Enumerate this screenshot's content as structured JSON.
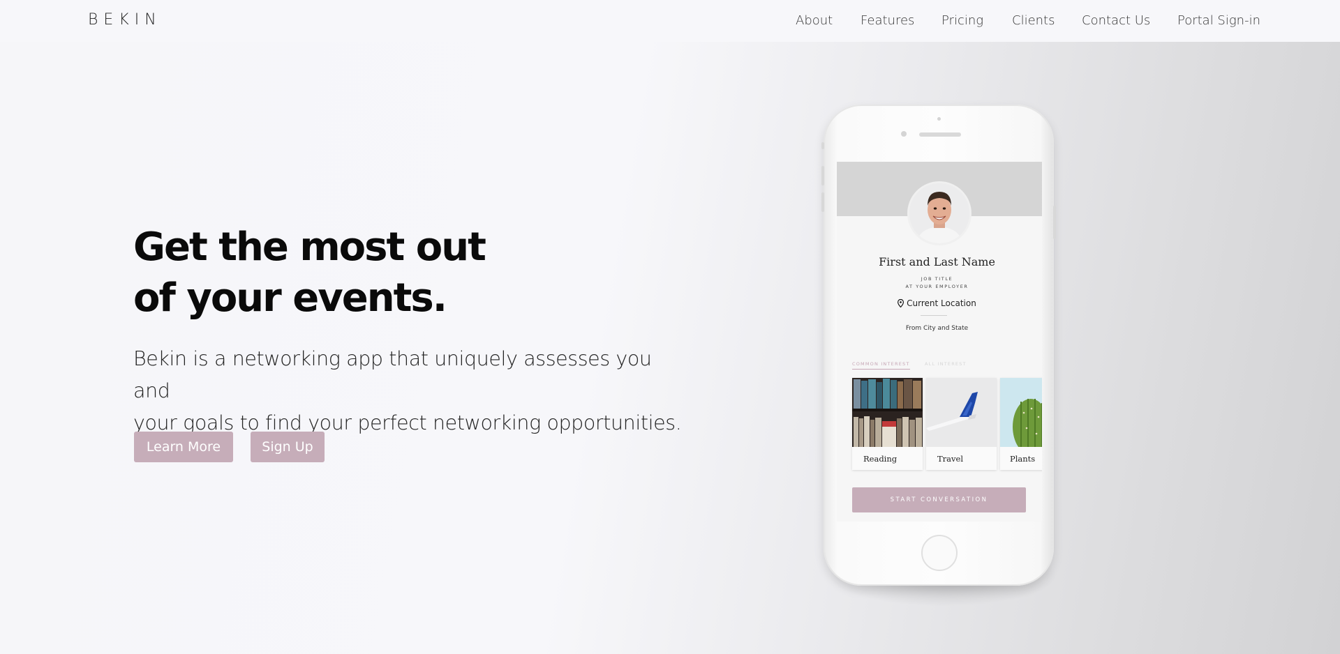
{
  "nav": {
    "logo": "BEKIN",
    "links": [
      "About",
      "Features",
      "Pricing",
      "Clients",
      "Contact Us",
      "Portal Sign-in"
    ]
  },
  "hero": {
    "title_line1": "Get the most out",
    "title_line2": "of your events.",
    "subtitle_line1": "Bekin is a networking app that uniquely assesses you and",
    "subtitle_line2": "your goals to find your perfect networking opportunities.",
    "learn_more_label": "Learn More",
    "sign_up_label": "Sign Up"
  },
  "phone_profile": {
    "name": "First and Last Name",
    "job_title": "JOB TITLE",
    "employer": "AT YOUR EMPLOYER",
    "location": "Current Location",
    "from": "From City and State",
    "tab_common": "COMMON INTEREST",
    "tab_all": "ALL INTEREST",
    "interests": [
      "Reading",
      "Travel",
      "Plants"
    ],
    "start_button": "START CONVERSATION"
  },
  "colors": {
    "accent": "#c6adb9",
    "text": "#0a0a0a",
    "background": "#f7f7fa"
  }
}
